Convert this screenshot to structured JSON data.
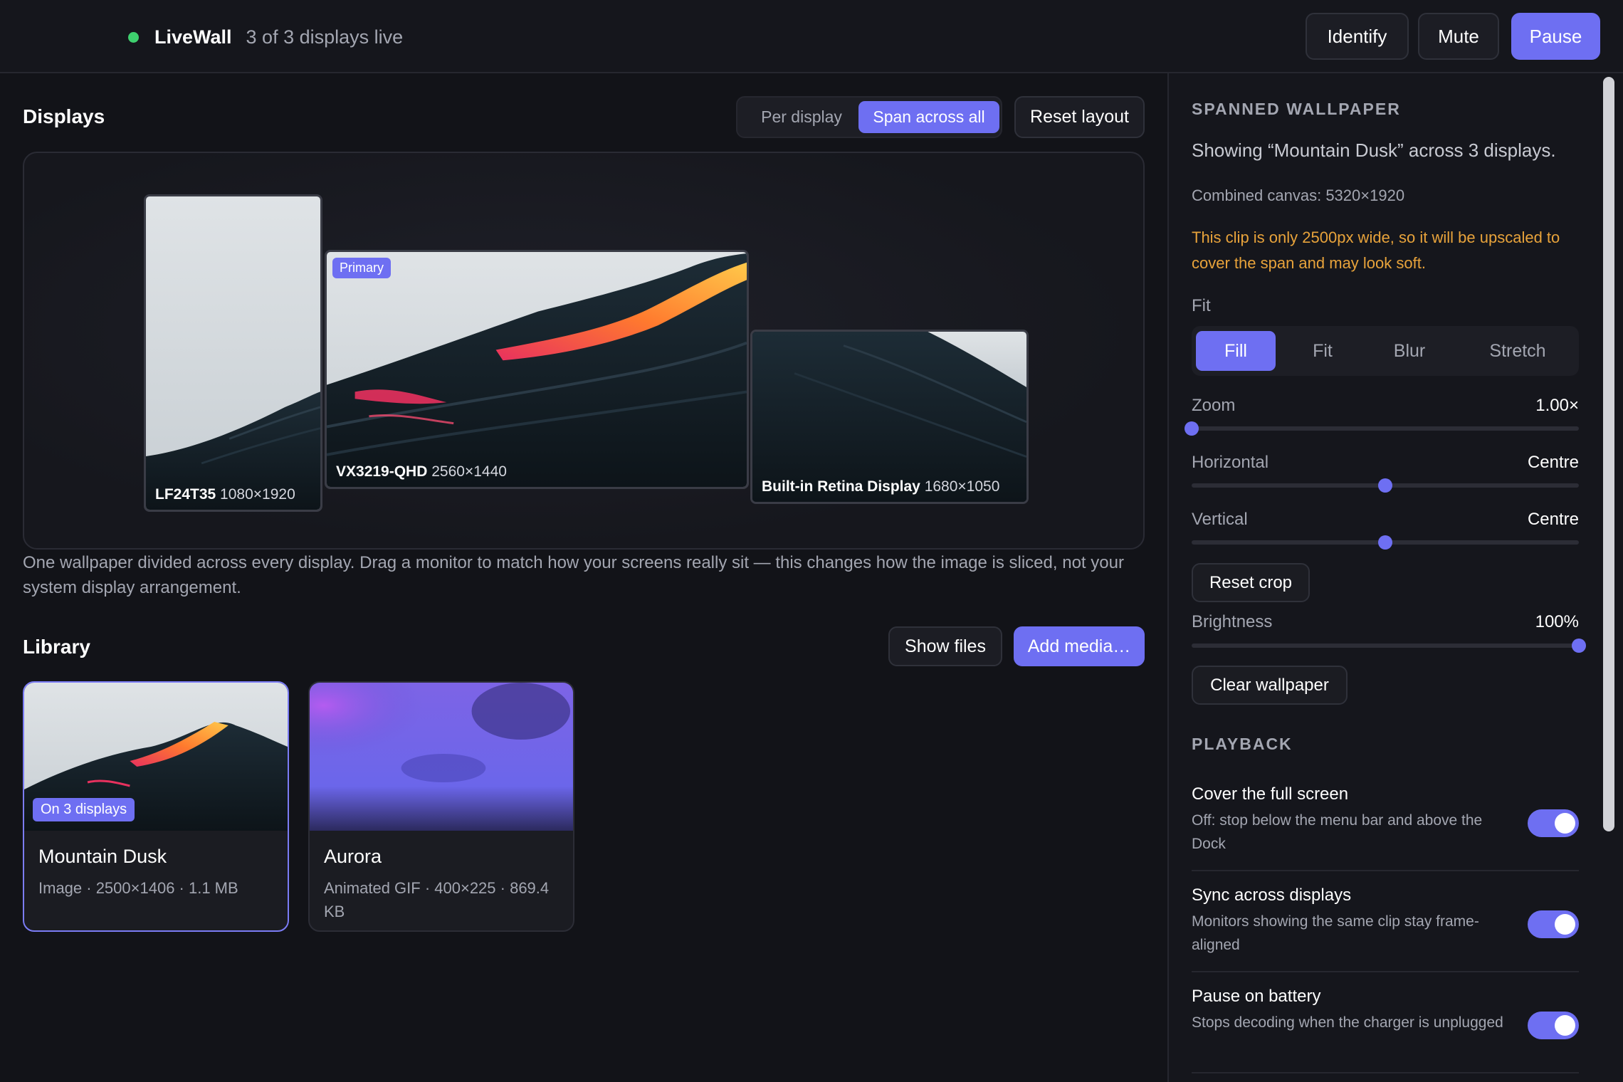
{
  "header": {
    "app_name": "LiveWall",
    "status": "3 of 3 displays live",
    "identify_label": "Identify",
    "mute_label": "Mute",
    "pause_label": "Pause"
  },
  "displays": {
    "title": "Displays",
    "mode_options": [
      "Per display",
      "Span across all"
    ],
    "mode_selected": "Span across all",
    "reset_layout_label": "Reset layout",
    "monitors": [
      {
        "name": "LF24T35",
        "resolution": "1080×1920",
        "primary": false
      },
      {
        "name": "VX3219-QHD",
        "resolution": "2560×1440",
        "primary": true
      },
      {
        "name": "Built-in Retina Display",
        "resolution": "1680×1050",
        "primary": false
      }
    ],
    "primary_badge": "Primary",
    "hint": "One wallpaper divided across every display. Drag a monitor to match how your screens really sit — this changes how the image is sliced, not your system display arrangement."
  },
  "library": {
    "title": "Library",
    "show_files_label": "Show files",
    "add_media_label": "Add media…",
    "items": [
      {
        "title": "Mountain Dusk",
        "meta": "Image · 2500×1406 · 1.1 MB",
        "badge": "On 3 displays",
        "selected": true
      },
      {
        "title": "Aurora",
        "meta": "Animated GIF · 400×225 · 869.4 KB",
        "badge": "",
        "selected": false
      }
    ]
  },
  "panel": {
    "section_title": "SPANNED WALLPAPER",
    "showing": "Showing “Mountain Dusk” across 3 displays.",
    "canvas": "Combined canvas: 5320×1920",
    "warning": "This clip is only 2500px wide, so it will be upscaled to cover the span and may look soft.",
    "fit_label": "Fit",
    "fit_options": [
      "Fill",
      "Fit",
      "Blur",
      "Stretch"
    ],
    "fit_selected": "Fill",
    "zoom": {
      "label": "Zoom",
      "value": "1.00×",
      "level": 0.0
    },
    "horizontal": {
      "label": "Horizontal",
      "value": "Centre",
      "level": 0.5
    },
    "vertical": {
      "label": "Vertical",
      "value": "Centre",
      "level": 0.5
    },
    "reset_crop_label": "Reset crop",
    "brightness": {
      "label": "Brightness",
      "value": "100%",
      "level": 1.0
    },
    "clear_label": "Clear wallpaper",
    "playback_title": "PLAYBACK",
    "toggles": [
      {
        "title": "Cover the full screen",
        "desc": "Off: stop below the menu bar and above the Dock",
        "on": true
      },
      {
        "title": "Sync across displays",
        "desc": "Monitors showing the same clip stay frame-aligned",
        "on": true
      },
      {
        "title": "Pause on battery",
        "desc": "Stops decoding when the charger is unplugged",
        "on": true
      }
    ]
  },
  "colors": {
    "accent": "#6e6ff2",
    "live": "#3ecf6e",
    "warning": "#e8a33b"
  }
}
